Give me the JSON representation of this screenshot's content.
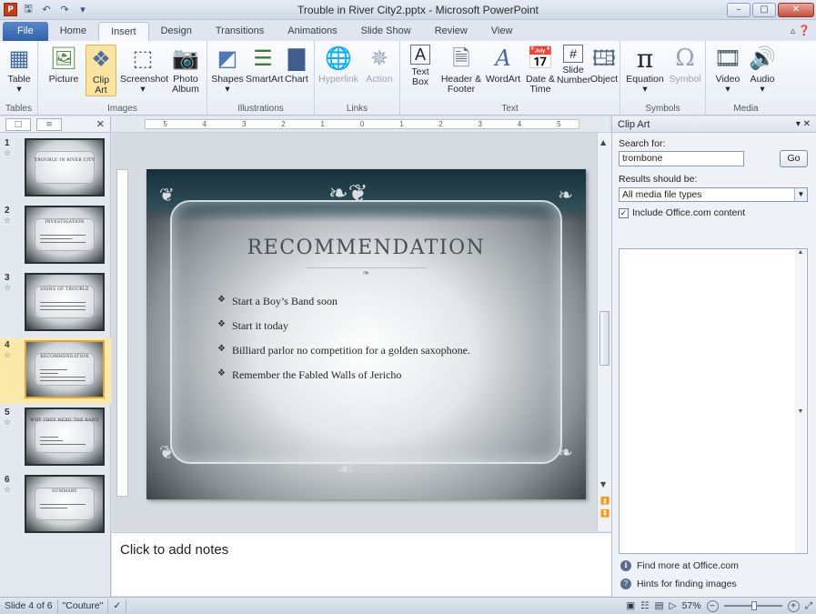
{
  "window": {
    "title": "Trouble in River City2.pptx - Microsoft PowerPoint",
    "app_icon": "P",
    "quick_access": [
      "save-icon",
      "undo-icon",
      "redo-icon",
      "customize-icon"
    ]
  },
  "tabs": [
    "File",
    "Home",
    "Insert",
    "Design",
    "Transitions",
    "Animations",
    "Slide Show",
    "Review",
    "View"
  ],
  "active_tab": "Insert",
  "ribbon": {
    "groups": {
      "tables": "Tables",
      "images": "Images",
      "illustrations": "Illustrations",
      "links": "Links",
      "text": "Text",
      "symbols": "Symbols",
      "media": "Media"
    },
    "buttons": {
      "table": "Table",
      "picture": "Picture",
      "clip_art": "Clip Art",
      "screenshot": "Screenshot",
      "photo_album": "Photo Album",
      "shapes": "Shapes",
      "smartart": "SmartArt",
      "chart": "Chart",
      "hyperlink": "Hyperlink",
      "action": "Action",
      "text_box": "Text Box",
      "header_footer": "Header & Footer",
      "wordart": "WordArt",
      "date_time": "Date & Time",
      "slide_number": "Slide Number",
      "object": "Object",
      "equation": "Equation",
      "symbol": "Symbol",
      "video": "Video",
      "audio": "Audio"
    }
  },
  "slides_pane": {
    "thumbnails": [
      {
        "num": "1",
        "title": "TROUBLE IN RIVER CITY"
      },
      {
        "num": "2",
        "title": "INVESTIGATION"
      },
      {
        "num": "3",
        "title": "SIGNS OF TROUBLE"
      },
      {
        "num": "4",
        "title": "RECOMMENDATION"
      },
      {
        "num": "5",
        "title": "WHY THEY NEED THE BAND"
      },
      {
        "num": "6",
        "title": "SUMMARY"
      }
    ]
  },
  "ruler": {
    "marks": [
      "5",
      "4",
      "3",
      "2",
      "1",
      "0",
      "1",
      "2",
      "3",
      "4",
      "5"
    ]
  },
  "slide": {
    "title": "RECOMMENDATION",
    "bullets": [
      "Start a Boy’s Band soon",
      "Start it today",
      "Billiard parlor no competition for a golden saxophone.",
      "Remember the Fabled Walls of Jericho"
    ]
  },
  "notes": {
    "placeholder": "Click to add notes"
  },
  "clip_art_pane": {
    "title": "Clip Art",
    "search_label": "Search for:",
    "search_value": "trombone",
    "go_label": "Go",
    "results_label": "Results should be:",
    "media_types": "All media file types",
    "include_office": "Include Office.com content",
    "find_more": "Find more at Office.com",
    "hints": "Hints for finding images"
  },
  "status_bar": {
    "slide_info": "Slide 4 of 6",
    "theme": "\"Couture\"",
    "zoom": "57%"
  }
}
